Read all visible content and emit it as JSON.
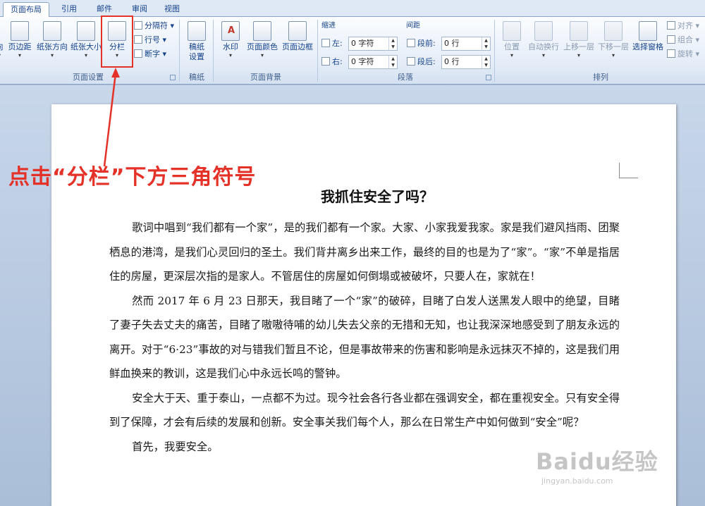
{
  "tabs": [
    "页面布局",
    "引用",
    "邮件",
    "审阅",
    "视图"
  ],
  "page_setup": {
    "group_label": "页面设置",
    "buttons": [
      "页边距",
      "纸张方向",
      "纸张大小",
      "分栏"
    ],
    "partial_label": "向",
    "small": [
      "分隔符",
      "行号",
      "断字"
    ]
  },
  "manuscript": {
    "group_label": "稿纸",
    "button_line1": "稿纸",
    "button_line2": "设置"
  },
  "page_background": {
    "group_label": "页面背景",
    "buttons": [
      "水印",
      "页面颜色",
      "页面边框"
    ]
  },
  "paragraph": {
    "group_label": "段落",
    "indent_label": "缩进",
    "spacing_label": "间距",
    "left_label": "左:",
    "right_label": "右:",
    "before_label": "段前:",
    "after_label": "段后:",
    "left_value": "0 字符",
    "right_value": "0 字符",
    "before_value": "0 行",
    "after_value": "0 行"
  },
  "arrange": {
    "group_label": "排列",
    "buttons": [
      "位置",
      "自动换行",
      "上移一层",
      "下移一层",
      "选择窗格"
    ],
    "small": [
      "对齐",
      "组合",
      "旋转"
    ]
  },
  "annotation": "点击“分栏”下方三角符号",
  "document": {
    "title": "我抓住安全了吗？",
    "paragraphs": [
      "歌词中唱到“我们都有一个家”，是的我们都有一个家。大家、小家我爱我家。家是我们避风挡雨、团聚栖息的港湾，是我们心灵回归的圣土。我们背井离乡出来工作，最终的目的也是为了“家”。“家”不单是指居住的房屋，更深层次指的是家人。不管居住的房屋如何倒塌或被破坏，只要人在，家就在！",
      "然而 2017 年 6 月 23 日那天，我目睹了一个“家”的破碎，目睹了白发人送黑发人眼中的绝望，目睹了妻子失去丈夫的痛苦，目睹了嗷嗷待哺的幼儿失去父亲的无措和无知，也让我深深地感受到了朋友永远的离开。对于“6·23”事故的对与错我们暂且不论，但是事故带来的伤害和影响是永远抹灭不掉的，这是我们用鲜血换来的教训，这是我们心中永远长鸣的警钟。",
      "安全大于天、重于泰山，一点都不为过。现今社会各行各业都在强调安全，都在重视安全。只有安全得到了保障，才会有后续的发展和创新。安全事关我们每个人，那么在日常生产中如何做到“安全”呢？",
      "首先，我要安全。"
    ]
  },
  "watermark": {
    "brand": "Baidu经验",
    "url": "jingyan.baidu.com"
  },
  "colors": {
    "annotation": "#e53228",
    "ribbon_text": "#15428b"
  }
}
